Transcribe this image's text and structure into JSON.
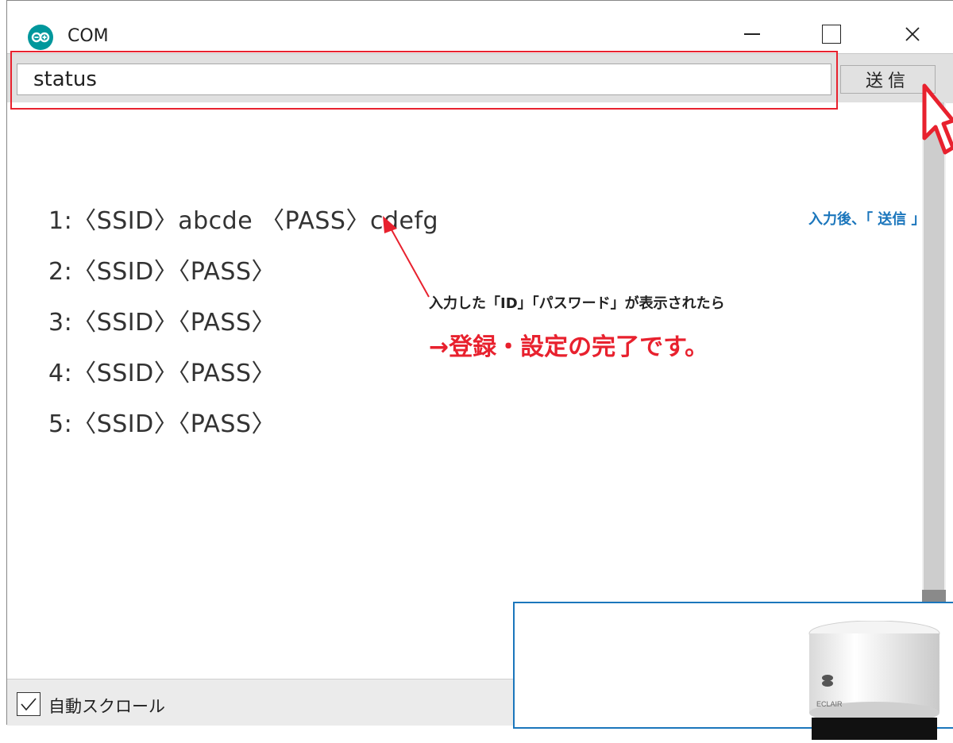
{
  "window": {
    "title": "COM",
    "icon": "arduino-infinity-icon"
  },
  "toolbar": {
    "input_value": "status",
    "send_label": "送信"
  },
  "output": {
    "lines": [
      "1:〈SSID〉abcde 〈PASS〉cdefg",
      "2:〈SSID〉〈PASS〉",
      "3:〈SSID〉〈PASS〉",
      "4:〈SSID〉〈PASS〉",
      "5:〈SSID〉〈PASS〉"
    ]
  },
  "bottombar": {
    "autoscroll_label": "自動スクロール",
    "autoscroll_checked": true
  },
  "annotations": {
    "note": "入力した「ID」「パスワード」が表示されたら",
    "emphasis": "→登録・設定の完了です。",
    "instruction": "入力後、「 送信 」",
    "device_label": "ECLAIR",
    "accent_red": "#e8212e",
    "accent_blue": "#1b76bc"
  }
}
